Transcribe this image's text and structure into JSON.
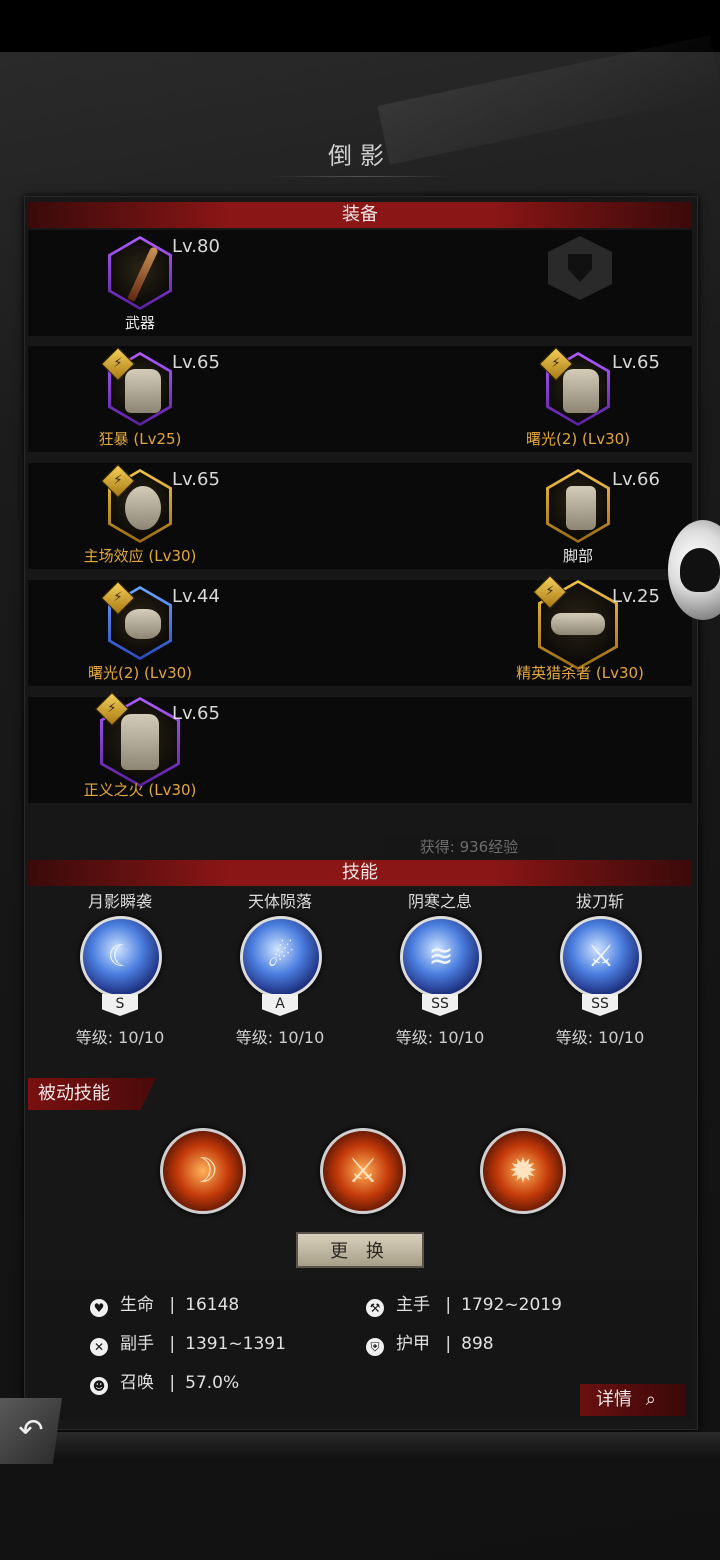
{
  "page_title": "倒影",
  "equipment": {
    "header": "装备",
    "slots": [
      {
        "name": "武器",
        "level": "Lv.80",
        "frame": "purple",
        "has_badge": false,
        "name_color": "white"
      },
      {
        "name": "",
        "level": "",
        "frame": "empty",
        "has_badge": false
      },
      {
        "name": "狂暴 (Lv25)",
        "level": "Lv.65",
        "frame": "purple",
        "has_badge": true,
        "name_color": "gold"
      },
      {
        "name": "曙光(2) (Lv30)",
        "level": "Lv.65",
        "frame": "purple",
        "has_badge": true,
        "name_color": "gold"
      },
      {
        "name": "主场效应 (Lv30)",
        "level": "Lv.65",
        "frame": "gold",
        "has_badge": true,
        "name_color": "gold"
      },
      {
        "name": "脚部",
        "level": "Lv.66",
        "frame": "gold",
        "has_badge": false,
        "name_color": "white"
      },
      {
        "name": "曙光(2) (Lv30)",
        "level": "Lv.44",
        "frame": "blue",
        "has_badge": true,
        "name_color": "gold"
      },
      {
        "name": "精英猎杀者 (Lv30)",
        "level": "Lv.25",
        "frame": "gold",
        "has_badge": true,
        "name_color": "gold"
      },
      {
        "name": "正义之火 (Lv30)",
        "level": "Lv.65",
        "frame": "purple",
        "has_badge": true,
        "name_color": "gold"
      }
    ]
  },
  "gain_text": "获得: 936经验",
  "skills": {
    "header": "技能",
    "items": [
      {
        "name": "月影瞬袭",
        "tier": "S",
        "level": "等级: 10/10",
        "icon": "moon-slash-icon"
      },
      {
        "name": "天体陨落",
        "tier": "A",
        "level": "等级: 10/10",
        "icon": "meteor-icon"
      },
      {
        "name": "阴寒之息",
        "tier": "SS",
        "level": "等级: 10/10",
        "icon": "frost-breath-icon"
      },
      {
        "name": "拔刀斩",
        "tier": "SS",
        "level": "等级: 10/10",
        "icon": "crossed-blades-icon"
      }
    ]
  },
  "passive": {
    "label": "被动技能",
    "items": [
      {
        "icon": "fire-slash-icon"
      },
      {
        "icon": "fire-sword-icon"
      },
      {
        "icon": "fire-mask-icon"
      }
    ]
  },
  "change_button": "更 换",
  "stats": {
    "hp_label": "生命",
    "hp_value": "16148",
    "main_label": "主手",
    "main_value": "1792~2019",
    "off_label": "副手",
    "off_value": "1391~1391",
    "armor_label": "护甲",
    "armor_value": "898",
    "summon_label": "召唤",
    "summon_value": "57.0%",
    "separator": "|"
  },
  "detail_button": "详情"
}
